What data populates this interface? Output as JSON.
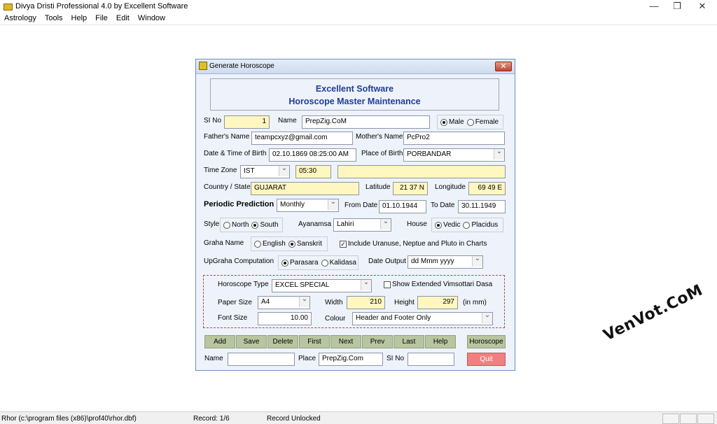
{
  "app": {
    "title": "Divya Dristi Professional 4.0 by Excellent Software",
    "window_controls": {
      "minimize": "—",
      "restore": "❐",
      "close": "✕"
    }
  },
  "menu": [
    "Astrology",
    "Tools",
    "Help",
    "File",
    "Edit",
    "Window"
  ],
  "dialog": {
    "title": "Generate Horoscope",
    "close": "✕",
    "header_line1": "Excellent Software",
    "header_line2": "Horoscope Master Maintenance",
    "si_no_label": "SI No",
    "si_no_value": "1",
    "name_label": "Name",
    "name_value": "PrepZig.CoM",
    "gender": {
      "male": "Male",
      "female": "Female",
      "selected": "Male"
    },
    "father_label": "Father's Name",
    "father_value": "teampcxyz@gmail.com",
    "mother_label": "Mother's Name",
    "mother_value": "PcPro2",
    "dob_label": "Date & Time of Birth",
    "dob_value": "02.10.1869 08:25:00 AM",
    "pob_label": "Place of Birth",
    "pob_value": "PORBANDAR",
    "tz_label": "Time Zone",
    "tz_value": "IST",
    "tz_offset": "05:30",
    "tz_extra": "",
    "country_label": "Country / State",
    "country_value": "GUJARAT",
    "lat_label": "Latitude",
    "lat_value": "21 37 N",
    "long_label": "Longitude",
    "long_value": "69 49 E",
    "periodic_label": "Periodic Prediction",
    "periodic_value": "Monthly",
    "from_label": "From Date",
    "from_value": "01.10.1944",
    "to_label": "To Date",
    "to_value": "30.11.1949",
    "style_label": "Style",
    "style": {
      "north": "North",
      "south": "South",
      "selected": "South"
    },
    "ayanamsa_label": "Ayanamsa",
    "ayanamsa_value": "Lahiri",
    "house_label": "House",
    "house": {
      "vedic": "Vedic",
      "placidus": "Placidus",
      "selected": "Vedic"
    },
    "graha_label": "Graha Name",
    "graha": {
      "english": "English",
      "sanskrit": "Sanskrit",
      "selected": "Sanskrit"
    },
    "include_label": "Include Uranuse, Neptue and Pluto in Charts",
    "include_checked": true,
    "upgraha_label": "UpGraha Computation",
    "upgraha": {
      "parasara": "Parasara",
      "kalidasa": "Kalidasa",
      "selected": "Parasara"
    },
    "date_output_label": "Date Output",
    "date_output_value": "dd Mmm yyyy",
    "horo_type_label": "Horoscope Type",
    "horo_type_value": "EXCEL SPECIAL",
    "show_ext_label": "Show Extended Vimsottari Dasa",
    "show_ext_checked": false,
    "paper_label": "Paper Size",
    "paper_value": "A4",
    "width_label": "Width",
    "width_value": "210",
    "height_label": "Height",
    "height_value": "297",
    "unit_label": "(in mm)",
    "font_label": "Font Size",
    "font_value": "10.00",
    "colour_label": "Colour",
    "colour_value": "Header and Footer Only",
    "buttons": [
      "Add",
      "Save",
      "Delete",
      "First",
      "Next",
      "Prev",
      "Last",
      "Help"
    ],
    "horoscope_button": "Horoscope",
    "quit_button": "Quit",
    "search_name_label": "Name",
    "search_name_value": "",
    "search_place_label": "Place",
    "search_place_value": "PrepZig.Com",
    "search_si_label": "SI No",
    "search_si_value": ""
  },
  "status": {
    "path": "Rhor (c:\\program files (x86)\\prof40\\rhor.dbf)",
    "record": "Record: 1/6",
    "lock": "Record Unlocked"
  },
  "watermark": "VenVot.CoM",
  "colors": {
    "dialog_bg": "#eef3fb",
    "header_text": "#1e3d9a",
    "field_yellow": "#fff7bf",
    "button_green": "#b8c6a0",
    "quit_red": "#f08080"
  }
}
